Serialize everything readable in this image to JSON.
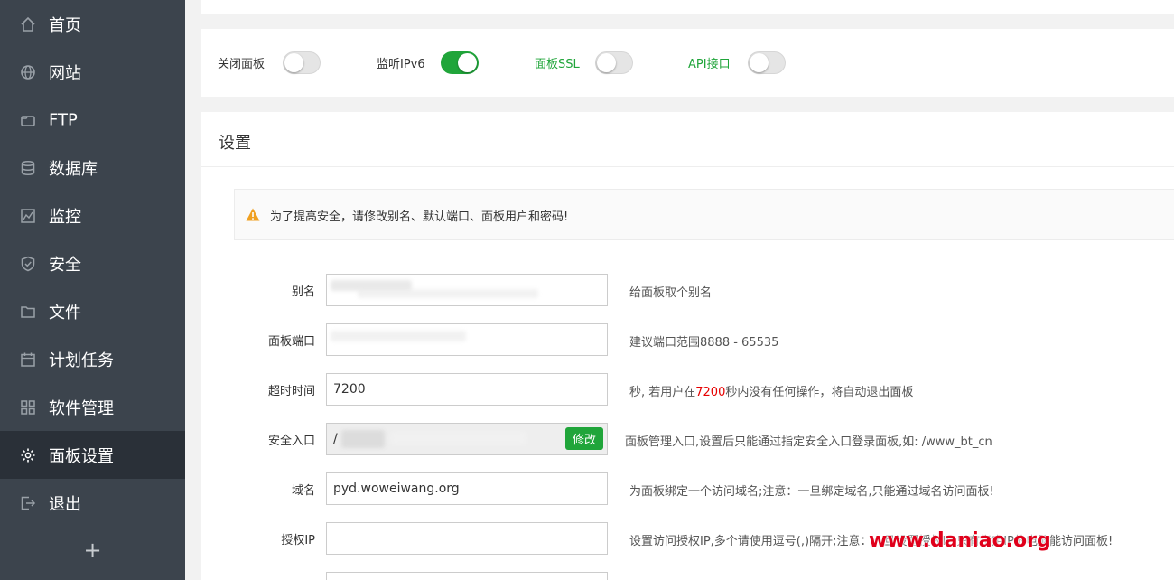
{
  "sidebar": {
    "items": [
      {
        "label": "首页",
        "icon": "home-icon"
      },
      {
        "label": "网站",
        "icon": "globe-icon"
      },
      {
        "label": "FTP",
        "icon": "ftp-icon"
      },
      {
        "label": "数据库",
        "icon": "database-icon"
      },
      {
        "label": "监控",
        "icon": "monitor-icon"
      },
      {
        "label": "安全",
        "icon": "shield-icon"
      },
      {
        "label": "文件",
        "icon": "folder-icon"
      },
      {
        "label": "计划任务",
        "icon": "calendar-icon"
      },
      {
        "label": "软件管理",
        "icon": "grid-icon"
      },
      {
        "label": "面板设置",
        "icon": "gear-icon"
      },
      {
        "label": "退出",
        "icon": "logout-icon"
      }
    ],
    "active_index": 9,
    "add_label": "+"
  },
  "toggles": [
    {
      "label": "关闭面板",
      "on": false,
      "accent": false
    },
    {
      "label": "监听IPv6",
      "on": true,
      "accent": false
    },
    {
      "label": "面板SSL",
      "on": false,
      "accent": true
    },
    {
      "label": "API接口",
      "on": false,
      "accent": true
    }
  ],
  "settings": {
    "title": "设置",
    "warning": "为了提高安全，请修改别名、默认端口、面板用户和密码!",
    "rows": [
      {
        "label": "别名",
        "value": "",
        "hint": "给面板取个别名"
      },
      {
        "label": "面板端口",
        "value": "",
        "hint": "建议端口范围8888 - 65535"
      },
      {
        "label": "超时时间",
        "value": "7200",
        "hint_before": "秒, 若用户在",
        "hint_highlight": "7200",
        "hint_after": "秒内没有任何操作，将自动退出面板"
      },
      {
        "label": "安全入口",
        "value": "/",
        "hint": "面板管理入口,设置后只能通过指定安全入口登录面板,如: /www_bt_cn",
        "button": "修改"
      },
      {
        "label": "域名",
        "value": "pyd.woweiwang.org",
        "hint": "为面板绑定一个访问域名;注意：一旦绑定域名,只能通过域名访问面板!"
      },
      {
        "label": "授权IP",
        "value": "",
        "hint": "设置访问授权IP,多个请使用逗号(,)隔开;注意：一旦设置授权IP,只有指定IP的电脑能访问面板!"
      }
    ]
  },
  "watermark": "www.daniao.org",
  "colors": {
    "accent": "#20a53a",
    "sidebar": "#3c444d",
    "sidebar_active": "#2a3038",
    "highlight": "#e60000"
  }
}
